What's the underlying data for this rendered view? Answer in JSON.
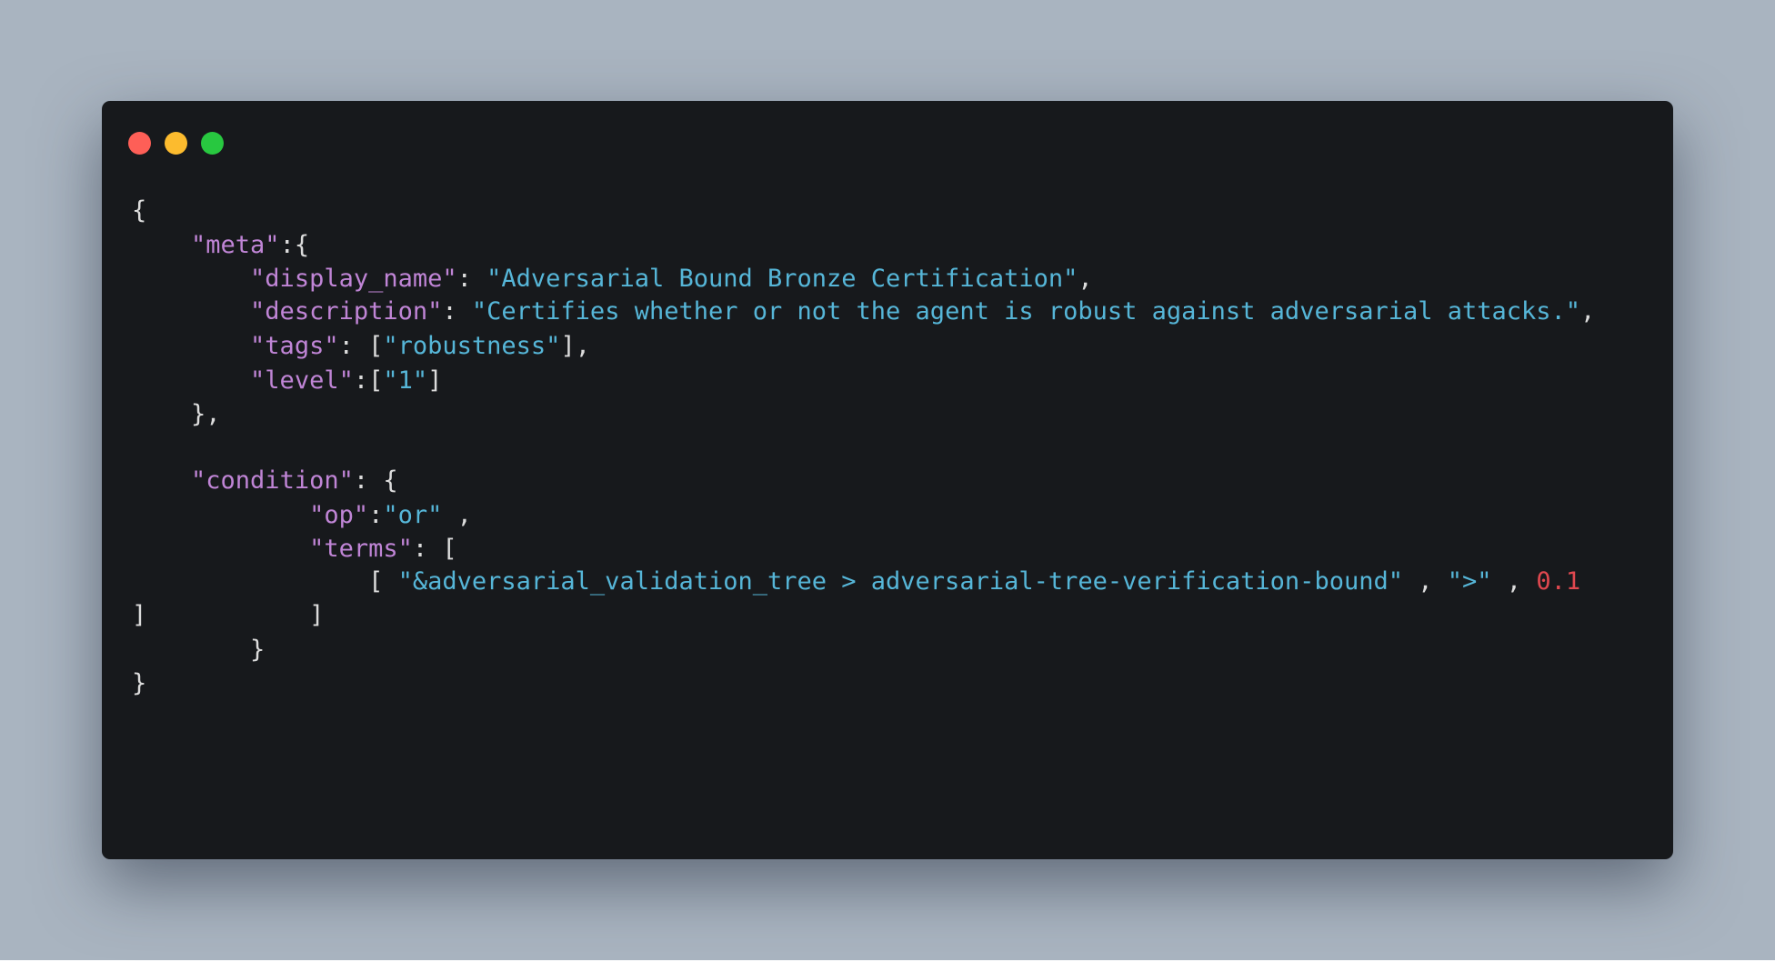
{
  "colors": {
    "background": "#a9b4c0",
    "window": "#17191c",
    "key": "#c085d6",
    "string": "#56b6d8",
    "number": "#e0484f",
    "punctuation": "#dcdcdc",
    "close_dot": "#fe5f57",
    "minimize_dot": "#fcbb2e",
    "zoom_dot": "#28c840"
  },
  "window_controls": [
    "close",
    "minimize",
    "zoom"
  ],
  "code": {
    "line1": {
      "p1": "{"
    },
    "line2": {
      "indent": "    ",
      "key": "\"meta\"",
      "p1": ":{"
    },
    "line3": {
      "indent": "        ",
      "key": "\"display_name\"",
      "p1": ": ",
      "s1": "\"Adversarial Bound Bronze Certification\"",
      "p2": ","
    },
    "line4": {
      "indent": "        ",
      "key": "\"description\"",
      "p1": ": ",
      "s1": "\"Certifies whether or not the agent is robust against adversarial attacks.\"",
      "p2": ","
    },
    "line5": {
      "indent": "        ",
      "key": "\"tags\"",
      "p1": ": [",
      "s1": "\"robustness\"",
      "p2": "],"
    },
    "line6": {
      "indent": "        ",
      "key": "\"level\"",
      "p1": ":[",
      "s1": "\"1\"",
      "p2": "]"
    },
    "line7": {
      "p1": "    },"
    },
    "line8": {
      "indent": "    ",
      "key": "\"condition\"",
      "p1": ": {"
    },
    "line9": {
      "indent": "            ",
      "key": "\"op\"",
      "p1": ":",
      "s1": "\"or\"",
      "p2": " ,"
    },
    "line10": {
      "indent": "            ",
      "key": "\"terms\"",
      "p1": ": ["
    },
    "line11": {
      "p1": "                [ ",
      "s1": "\"&adversarial_validation_tree > adversarial-tree-verification-bound\"",
      "p2": " , ",
      "s2": "\">\"",
      "p3": " , ",
      "n1": "0.1"
    },
    "line12": {
      "p1": "]           ]"
    },
    "line13": {
      "p1": "        }"
    },
    "line14": {
      "p1": "}"
    }
  }
}
